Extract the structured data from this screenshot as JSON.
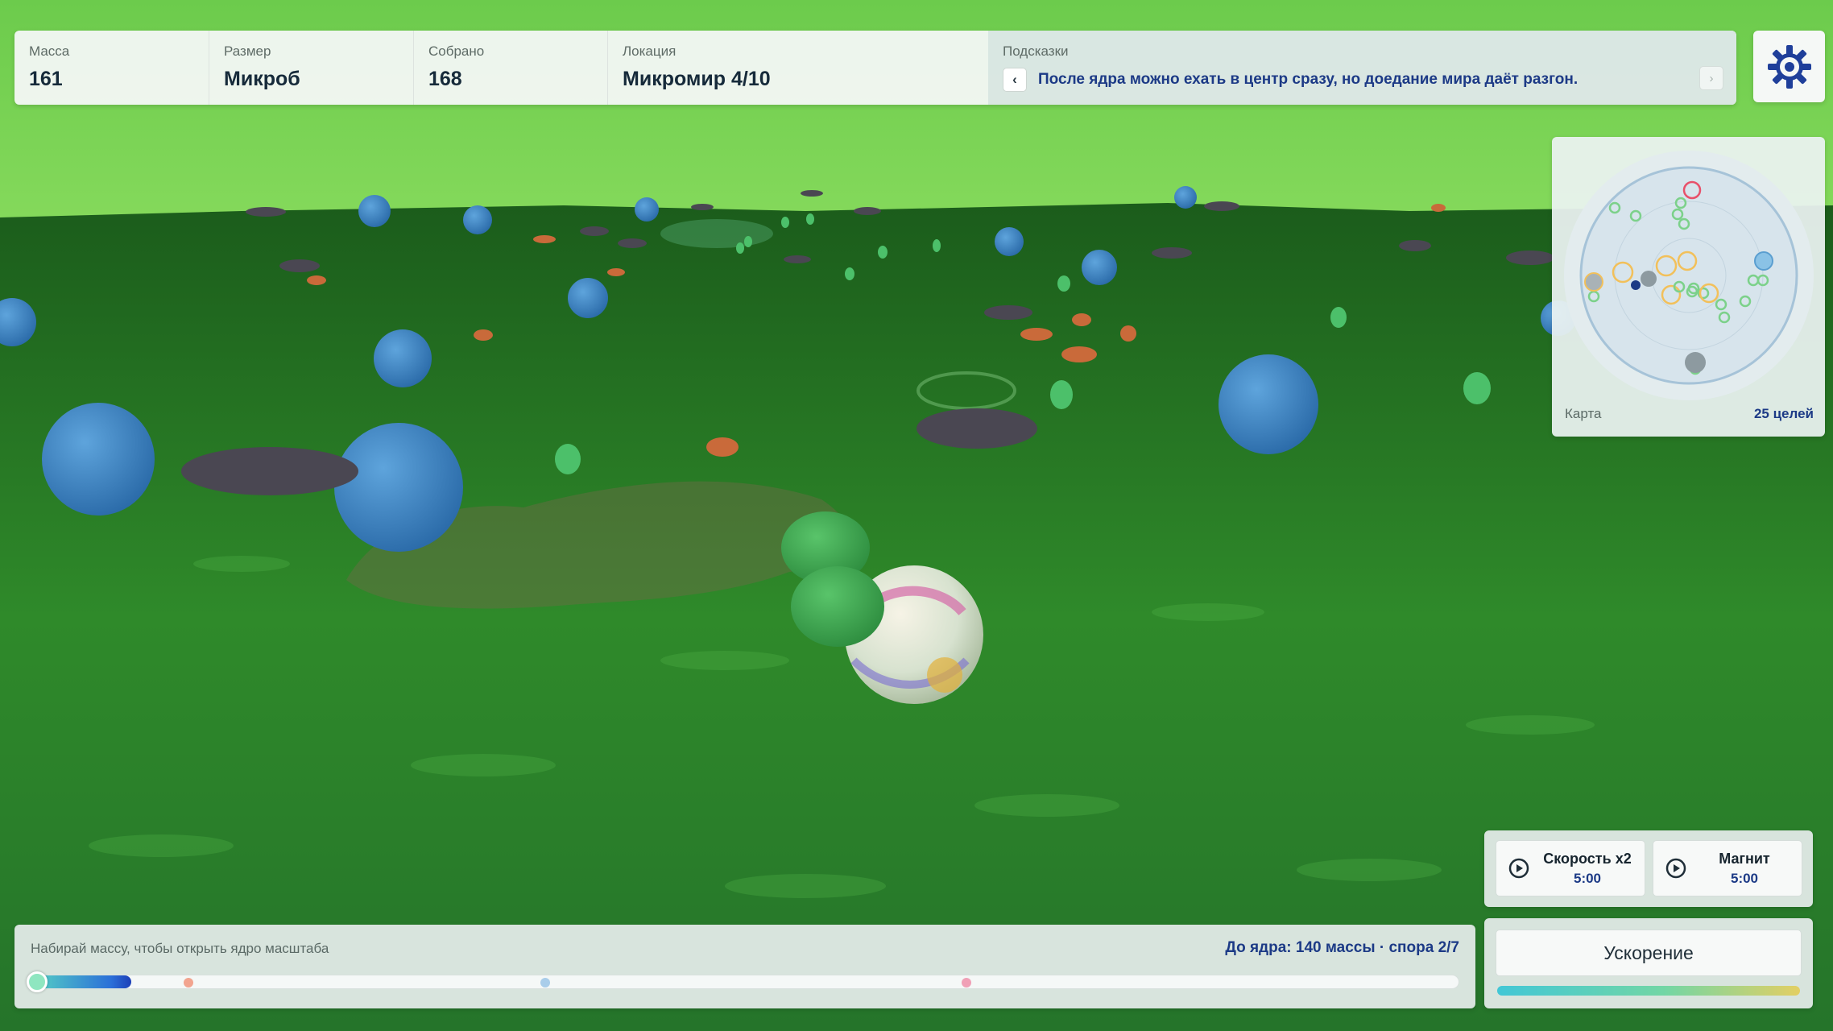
{
  "hud": {
    "mass": {
      "label": "Масса",
      "value": "161"
    },
    "size": {
      "label": "Размер",
      "value": "Микроб"
    },
    "collected": {
      "label": "Собрано",
      "value": "168"
    },
    "location": {
      "label": "Локация",
      "value": "Микромир 4/10"
    },
    "hints": {
      "label": "Подсказки",
      "text": "После ядра можно ехать в центр сразу, но доедание мира даёт разгон.",
      "prev_icon": "chevron-left-icon",
      "next_icon": "chevron-right-icon"
    },
    "settings_icon": "gear-icon"
  },
  "minimap": {
    "label": "Карта",
    "targets": "25 целей"
  },
  "progress": {
    "left_text": "Набирай массу, чтобы открыть ядро масштаба",
    "right_text": "До ядра: 140 массы · спора 2/7",
    "fill_fraction": 0.07,
    "spores": [
      {
        "position": 0.11,
        "color": "#f2a48f"
      },
      {
        "position": 0.36,
        "color": "#a9cdea"
      },
      {
        "position": 0.655,
        "color": "#f0a0b6"
      }
    ]
  },
  "boosters": [
    {
      "name": "Скорость x2",
      "time": "5:00",
      "icon": "play-circle-icon"
    },
    {
      "name": "Магнит",
      "time": "5:00",
      "icon": "play-circle-icon"
    }
  ],
  "accelerate": {
    "label": "Ускорение",
    "charge_fraction": 1.0
  },
  "colors": {
    "accent": "#1c3a86",
    "sky": "#7fd35a",
    "ground": "#2c7a25"
  }
}
